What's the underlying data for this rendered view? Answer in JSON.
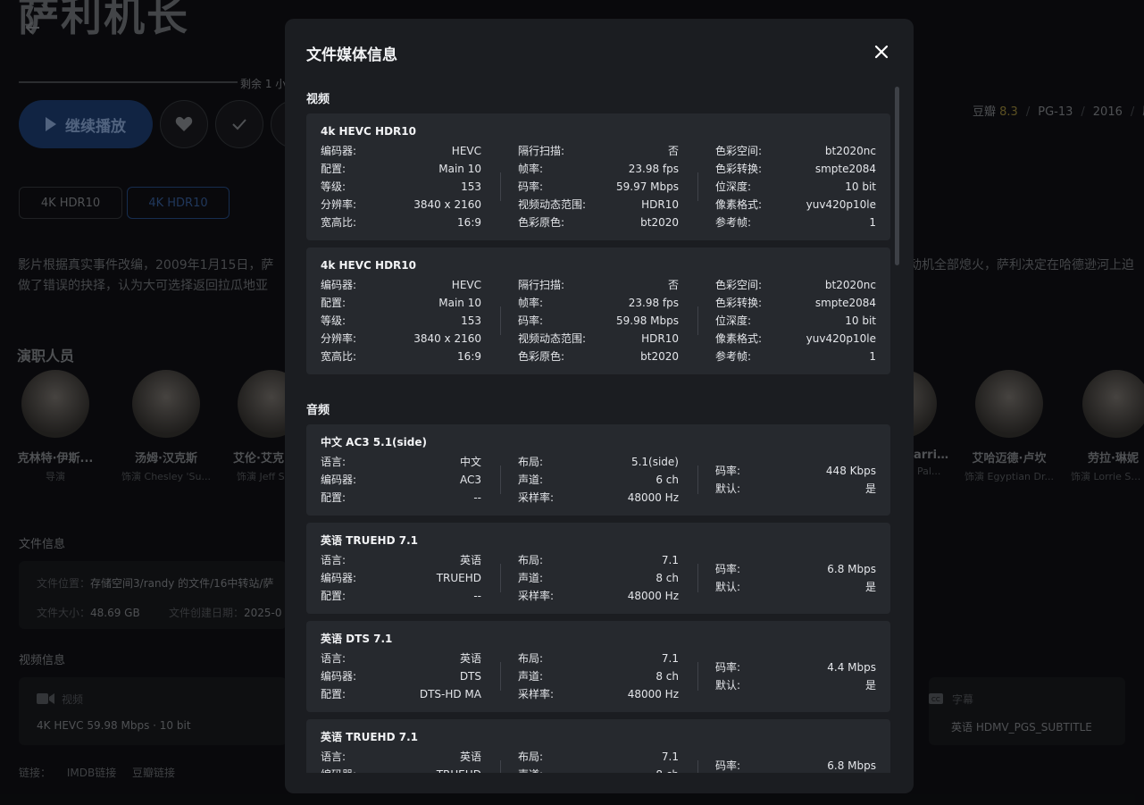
{
  "background": {
    "title": "萨利机长",
    "remaining": "剩余 1 小",
    "play_label": "继续播放",
    "versions": [
      "4K HDR10",
      "4K HDR10"
    ],
    "meta": {
      "site": "豆瓣",
      "score": "8.3",
      "rating": "PG-13",
      "year": "2016",
      "extra": "剧"
    },
    "description_left_1": "影片根据真实事件改编，2009年1月15日，萨",
    "description_left_2": "做了错误的抉择，认为大可选择返回拉瓜地亚",
    "description_right_1": "动机全部熄火，萨利决定在哈德逊河上迫",
    "cast_heading": "演职人员",
    "cast": [
      {
        "name": "克林特·伊斯...",
        "role": "导演"
      },
      {
        "name": "汤姆·汉克斯",
        "role": "饰演 Chesley 'Su..."
      },
      {
        "name": "艾伦·艾克",
        "role": "饰演 Jeff S"
      },
      {
        "name": "arrin...",
        "role": "Pal..."
      },
      {
        "name": "艾哈迈德·卢坎",
        "role": "饰演 Egyptian Dr..."
      },
      {
        "name": "劳拉·琳妮",
        "role": "饰演 Lorrie Sulle"
      }
    ],
    "file_info_heading": "文件信息",
    "file_location_label": "文件位置：",
    "file_location_value": "存储空间3/randy 的文件/16中转站/萨",
    "file_size_label": "文件大小：",
    "file_size_value": "48.69 GB",
    "file_created_label": "文件创建日期：",
    "file_created_value": "2025-0",
    "video_info_heading": "视频信息",
    "video_label": "视频",
    "video_value": "4K HEVC 59.98 Mbps · 10 bit",
    "subtitle_label": "字幕",
    "subtitle_value": "英语 HDMV_PGS_SUBTITLE",
    "links_label": "链接：",
    "link_imdb": "IMDB链接",
    "link_douban": "豆瓣链接"
  },
  "modal": {
    "title": "文件媒体信息",
    "video_heading": "视频",
    "audio_heading": "音频",
    "video_tracks": [
      {
        "title": "4k HEVC HDR10",
        "col1": [
          [
            "编码器:",
            "HEVC"
          ],
          [
            "配置:",
            "Main 10"
          ],
          [
            "等级:",
            "153"
          ],
          [
            "分辨率:",
            "3840 x 2160"
          ],
          [
            "宽高比:",
            "16:9"
          ]
        ],
        "col2": [
          [
            "隔行扫描:",
            "否"
          ],
          [
            "帧率:",
            "23.98 fps"
          ],
          [
            "码率:",
            "59.97 Mbps"
          ],
          [
            "视频动态范围:",
            "HDR10"
          ],
          [
            "色彩原色:",
            "bt2020"
          ]
        ],
        "col3": [
          [
            "色彩空间:",
            "bt2020nc"
          ],
          [
            "色彩转换:",
            "smpte2084"
          ],
          [
            "位深度:",
            "10 bit"
          ],
          [
            "像素格式:",
            "yuv420p10le"
          ],
          [
            "参考帧:",
            "1"
          ]
        ]
      },
      {
        "title": "4k HEVC HDR10",
        "col1": [
          [
            "编码器:",
            "HEVC"
          ],
          [
            "配置:",
            "Main 10"
          ],
          [
            "等级:",
            "153"
          ],
          [
            "分辨率:",
            "3840 x 2160"
          ],
          [
            "宽高比:",
            "16:9"
          ]
        ],
        "col2": [
          [
            "隔行扫描:",
            "否"
          ],
          [
            "帧率:",
            "23.98 fps"
          ],
          [
            "码率:",
            "59.98 Mbps"
          ],
          [
            "视频动态范围:",
            "HDR10"
          ],
          [
            "色彩原色:",
            "bt2020"
          ]
        ],
        "col3": [
          [
            "色彩空间:",
            "bt2020nc"
          ],
          [
            "色彩转换:",
            "smpte2084"
          ],
          [
            "位深度:",
            "10 bit"
          ],
          [
            "像素格式:",
            "yuv420p10le"
          ],
          [
            "参考帧:",
            "1"
          ]
        ]
      }
    ],
    "audio_tracks": [
      {
        "title": "中文 AC3 5.1(side)",
        "col1": [
          [
            "语言:",
            "中文"
          ],
          [
            "编码器:",
            "AC3"
          ],
          [
            "配置:",
            "--"
          ]
        ],
        "col2": [
          [
            "布局:",
            "5.1(side)"
          ],
          [
            "声道:",
            "6 ch"
          ],
          [
            "采样率:",
            "48000 Hz"
          ]
        ],
        "col3": [
          [
            "码率:",
            "448 Kbps"
          ],
          [
            "默认:",
            "是"
          ]
        ]
      },
      {
        "title": "英语 TRUEHD 7.1",
        "col1": [
          [
            "语言:",
            "英语"
          ],
          [
            "编码器:",
            "TRUEHD"
          ],
          [
            "配置:",
            "--"
          ]
        ],
        "col2": [
          [
            "布局:",
            "7.1"
          ],
          [
            "声道:",
            "8 ch"
          ],
          [
            "采样率:",
            "48000 Hz"
          ]
        ],
        "col3": [
          [
            "码率:",
            "6.8 Mbps"
          ],
          [
            "默认:",
            "是"
          ]
        ]
      },
      {
        "title": "英语 DTS 7.1",
        "col1": [
          [
            "语言:",
            "英语"
          ],
          [
            "编码器:",
            "DTS"
          ],
          [
            "配置:",
            "DTS-HD MA"
          ]
        ],
        "col2": [
          [
            "布局:",
            "7.1"
          ],
          [
            "声道:",
            "8 ch"
          ],
          [
            "采样率:",
            "48000 Hz"
          ]
        ],
        "col3": [
          [
            "码率:",
            "4.4 Mbps"
          ],
          [
            "默认:",
            "是"
          ]
        ]
      },
      {
        "title": "英语 TRUEHD 7.1",
        "col1": [
          [
            "语言:",
            "英语"
          ],
          [
            "编码器:",
            "TRUEHD"
          ],
          [
            "配置:",
            "--"
          ]
        ],
        "col2": [
          [
            "布局:",
            "7.1"
          ],
          [
            "声道:",
            "8 ch"
          ],
          [
            "采样率:",
            "48000 Hz"
          ]
        ],
        "col3": [
          [
            "码率:",
            "6.8 Mbps"
          ],
          [
            "默认:",
            "是"
          ]
        ]
      }
    ]
  },
  "colors": {
    "modal_bg": "#1b1d21",
    "card_bg": "#26292e",
    "page_bg": "#0c0d10",
    "accent": "#17315a"
  },
  "icons": [
    "back-arrow-icon",
    "play-icon",
    "heart-icon",
    "check-icon",
    "close-icon",
    "video-camera-icon",
    "subtitle-icon"
  ]
}
